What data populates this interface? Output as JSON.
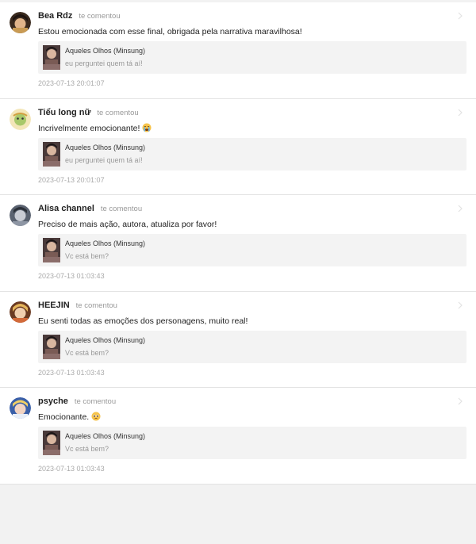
{
  "comments": [
    {
      "author": "Bea Rdz",
      "action": "te comentou",
      "text": "Estou emocionada com esse final, obrigada pela narrativa maravilhosa!",
      "emoji": "",
      "ref_title": "Aqueles Olhos (Minsung)",
      "ref_sub": "eu perguntei quem tá aí!",
      "time": "2023-07-13 20:01:07",
      "avatar_icon": "avatar-dark-hair"
    },
    {
      "author": "Tiểu long nữ",
      "action": "te comentou",
      "text": "Incrivelmente emocionante!",
      "emoji": "crying-face-emoji",
      "ref_title": "Aqueles Olhos (Minsung)",
      "ref_sub": "eu perguntei quem tá aí!",
      "time": "2023-07-13 20:01:07",
      "avatar_icon": "avatar-cartoon"
    },
    {
      "author": "Alisa channel",
      "action": "te comentou",
      "text": "Preciso de mais ação, autora, atualiza por favor!",
      "emoji": "",
      "ref_title": "Aqueles Olhos (Minsung)",
      "ref_sub": "Vc está bem?",
      "time": "2023-07-13 01:03:43",
      "avatar_icon": "avatar-grey"
    },
    {
      "author": "HEEJIN",
      "action": "te comentou",
      "text": "Eu senti todas as emoções dos personagens, muito real!",
      "emoji": "",
      "ref_title": "Aqueles Olhos (Minsung)",
      "ref_sub": "Vc está bem?",
      "time": "2023-07-13 01:03:43",
      "avatar_icon": "avatar-blonde"
    },
    {
      "author": "psyche",
      "action": "te comentou",
      "text": "Emocionante.",
      "emoji": "pleading-face-emoji",
      "ref_title": "Aqueles Olhos (Minsung)",
      "ref_sub": "Vc está bem?",
      "time": "2023-07-13 01:03:43",
      "avatar_icon": "avatar-blue"
    }
  ]
}
